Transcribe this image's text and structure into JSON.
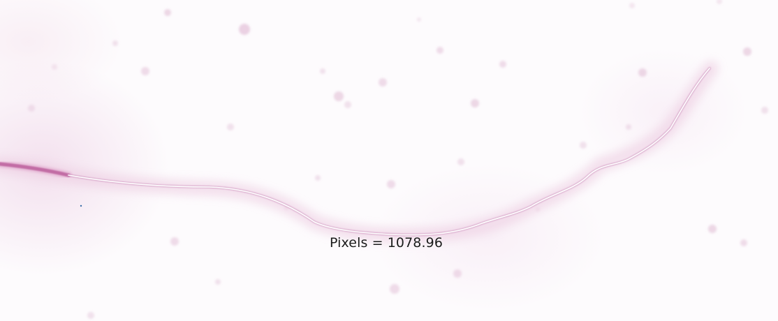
{
  "measurement": {
    "label": "Pixels = 1078.96"
  },
  "colors": {
    "background": "#fdfbfd",
    "stain_halo": "#e9c6dd",
    "trace_line": "#ffffff",
    "stained_segment": "#b0508f",
    "speckle": "#e6c7dc",
    "label_text": "#1b1b1b"
  }
}
